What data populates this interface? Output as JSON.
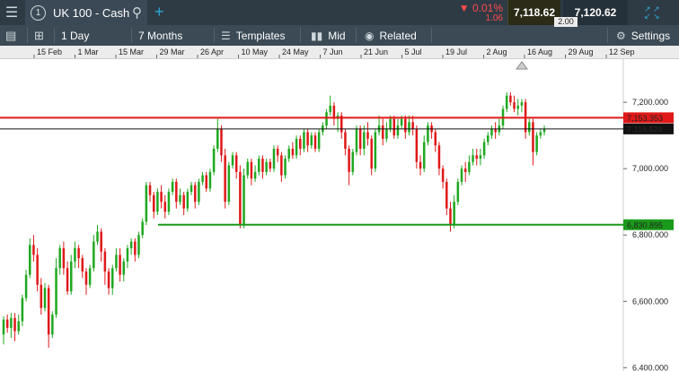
{
  "topbar": {
    "menu_icon": "hamburger-menu-icon",
    "instrument_number": "1",
    "instrument_name": "UK 100 - Cash",
    "change_pct": "▼ 0.01%",
    "change_pts": "1.06",
    "sell_price": "7,118.62",
    "buy_price": "7,120.62",
    "spread": "2.00"
  },
  "toolbar": {
    "interval": "1 Day",
    "period": "7 Months",
    "templates_label": "Templates",
    "price_type": "Mid",
    "related_label": "Related",
    "settings_label": "Settings"
  },
  "colors": {
    "up": "#1fa81f",
    "down": "#e01818",
    "resistance": "#e01818",
    "support": "#1a9a1a",
    "current": "#111111"
  },
  "chart_data": {
    "type": "candlestick",
    "x_ticks": [
      "15 Feb",
      "1 Mar",
      "15 Mar",
      "29 Mar",
      "26 Apr",
      "10 May",
      "24 May",
      "7 Jun",
      "21 Jun",
      "5 Jul",
      "19 Jul",
      "2 Aug",
      "16 Aug",
      "29 Aug",
      "12 Sep"
    ],
    "y_ticks": [
      "7,200.000",
      "7,000.000",
      "6,800.000",
      "6,600.000",
      "6,400.000"
    ],
    "ylim": [
      6390,
      7330
    ],
    "lines": [
      {
        "label": "7,153.353",
        "value": 7153.353,
        "color": "#e01818"
      },
      {
        "label": "7,119.620",
        "value": 7119.62,
        "color": "#111111"
      },
      {
        "label": "6,830.895",
        "value": 6830.895,
        "color": "#1a9a1a"
      }
    ],
    "candles": [
      [
        6500,
        6545,
        6470,
        6555
      ],
      [
        6545,
        6520,
        6505,
        6560
      ],
      [
        6520,
        6550,
        6490,
        6565
      ],
      [
        6550,
        6510,
        6480,
        6565
      ],
      [
        6510,
        6540,
        6500,
        6560
      ],
      [
        6540,
        6610,
        6525,
        6620
      ],
      [
        6610,
        6680,
        6600,
        6695
      ],
      [
        6680,
        6770,
        6670,
        6790
      ],
      [
        6770,
        6740,
        6720,
        6800
      ],
      [
        6740,
        6650,
        6630,
        6760
      ],
      [
        6650,
        6580,
        6560,
        6670
      ],
      [
        6580,
        6640,
        6570,
        6655
      ],
      [
        6640,
        6500,
        6460,
        6650
      ],
      [
        6500,
        6560,
        6490,
        6570
      ],
      [
        6560,
        6700,
        6550,
        6730
      ],
      [
        6700,
        6760,
        6680,
        6770
      ],
      [
        6760,
        6700,
        6680,
        6780
      ],
      [
        6700,
        6630,
        6620,
        6720
      ],
      [
        6630,
        6720,
        6620,
        6740
      ],
      [
        6720,
        6760,
        6700,
        6780
      ],
      [
        6760,
        6730,
        6700,
        6770
      ],
      [
        6730,
        6690,
        6670,
        6740
      ],
      [
        6690,
        6650,
        6620,
        6700
      ],
      [
        6650,
        6700,
        6640,
        6710
      ],
      [
        6700,
        6780,
        6690,
        6800
      ],
      [
        6780,
        6810,
        6770,
        6830
      ],
      [
        6810,
        6750,
        6720,
        6820
      ],
      [
        6750,
        6690,
        6650,
        6760
      ],
      [
        6690,
        6640,
        6620,
        6700
      ],
      [
        6640,
        6700,
        6620,
        6710
      ],
      [
        6700,
        6740,
        6690,
        6760
      ],
      [
        6740,
        6680,
        6660,
        6760
      ],
      [
        6680,
        6720,
        6660,
        6730
      ],
      [
        6720,
        6760,
        6700,
        6770
      ],
      [
        6760,
        6780,
        6740,
        6790
      ],
      [
        6780,
        6740,
        6720,
        6790
      ],
      [
        6740,
        6800,
        6730,
        6810
      ],
      [
        6800,
        6840,
        6790,
        6850
      ],
      [
        6840,
        6950,
        6830,
        6960
      ],
      [
        6950,
        6920,
        6900,
        6960
      ],
      [
        6920,
        6870,
        6850,
        6930
      ],
      [
        6870,
        6930,
        6860,
        6940
      ],
      [
        6930,
        6900,
        6880,
        6950
      ],
      [
        6900,
        6870,
        6850,
        6920
      ],
      [
        6870,
        6930,
        6860,
        6940
      ],
      [
        6930,
        6960,
        6920,
        6970
      ],
      [
        6960,
        6900,
        6880,
        6970
      ],
      [
        6900,
        6920,
        6890,
        6940
      ],
      [
        6920,
        6880,
        6860,
        6930
      ],
      [
        6880,
        6930,
        6870,
        6940
      ],
      [
        6930,
        6950,
        6920,
        6960
      ],
      [
        6950,
        6900,
        6880,
        6960
      ],
      [
        6900,
        6960,
        6890,
        6970
      ],
      [
        6960,
        6980,
        6950,
        6990
      ],
      [
        6980,
        6940,
        6930,
        6990
      ],
      [
        6940,
        6990,
        6930,
        7000
      ],
      [
        6990,
        7060,
        6980,
        7070
      ],
      [
        7060,
        7120,
        7050,
        7150
      ],
      [
        7120,
        7040,
        7020,
        7130
      ],
      [
        7040,
        6900,
        6880,
        7060
      ],
      [
        6900,
        7010,
        6890,
        7020
      ],
      [
        7010,
        7040,
        7000,
        7050
      ],
      [
        7040,
        6990,
        6970,
        7050
      ],
      [
        6990,
        6830,
        6820,
        7010
      ],
      [
        6830,
        6980,
        6820,
        7000
      ],
      [
        6980,
        7020,
        6970,
        7030
      ],
      [
        7020,
        6970,
        6950,
        7030
      ],
      [
        6970,
        6990,
        6960,
        7010
      ],
      [
        6990,
        7030,
        6980,
        7040
      ],
      [
        7030,
        6990,
        6970,
        7040
      ],
      [
        6990,
        7020,
        6980,
        7030
      ],
      [
        7020,
        7000,
        6990,
        7030
      ],
      [
        7000,
        7060,
        6990,
        7070
      ],
      [
        7060,
        7040,
        7020,
        7070
      ],
      [
        7040,
        6980,
        6960,
        7050
      ],
      [
        6980,
        7030,
        6970,
        7040
      ],
      [
        7030,
        7060,
        7020,
        7070
      ],
      [
        7060,
        7040,
        7030,
        7080
      ],
      [
        7040,
        7090,
        7030,
        7100
      ],
      [
        7090,
        7060,
        7040,
        7100
      ],
      [
        7060,
        7110,
        7050,
        7120
      ],
      [
        7110,
        7070,
        7050,
        7120
      ],
      [
        7070,
        7100,
        7060,
        7110
      ],
      [
        7100,
        7060,
        7050,
        7110
      ],
      [
        7060,
        7110,
        7050,
        7120
      ],
      [
        7110,
        7130,
        7100,
        7140
      ],
      [
        7130,
        7170,
        7120,
        7180
      ],
      [
        7170,
        7190,
        7160,
        7220
      ],
      [
        7190,
        7150,
        7130,
        7200
      ],
      [
        7150,
        7160,
        7110,
        7170
      ],
      [
        7160,
        7110,
        7090,
        7170
      ],
      [
        7110,
        7060,
        7040,
        7120
      ],
      [
        7060,
        6990,
        6950,
        7070
      ],
      [
        6990,
        7050,
        6980,
        7060
      ],
      [
        7050,
        7120,
        7040,
        7130
      ],
      [
        7120,
        7060,
        7040,
        7130
      ],
      [
        7060,
        7110,
        7040,
        7130
      ],
      [
        7110,
        7090,
        7070,
        7140
      ],
      [
        7090,
        7000,
        6980,
        7100
      ],
      [
        7000,
        7110,
        6990,
        7120
      ],
      [
        7110,
        7130,
        7100,
        7160
      ],
      [
        7130,
        7090,
        7070,
        7150
      ],
      [
        7090,
        7120,
        7080,
        7140
      ],
      [
        7120,
        7150,
        7110,
        7160
      ],
      [
        7150,
        7100,
        7090,
        7160
      ],
      [
        7100,
        7130,
        7090,
        7150
      ],
      [
        7130,
        7150,
        7120,
        7160
      ],
      [
        7150,
        7110,
        7090,
        7160
      ],
      [
        7110,
        7140,
        7100,
        7160
      ],
      [
        7140,
        7120,
        7100,
        7160
      ],
      [
        7120,
        7020,
        7000,
        7130
      ],
      [
        7020,
        7000,
        6980,
        7040
      ],
      [
        7000,
        7080,
        6990,
        7100
      ],
      [
        7080,
        7130,
        7070,
        7140
      ],
      [
        7130,
        7110,
        7090,
        7140
      ],
      [
        7110,
        7070,
        7050,
        7120
      ],
      [
        7070,
        7000,
        6980,
        7080
      ],
      [
        7000,
        6960,
        6940,
        7010
      ],
      [
        6960,
        6880,
        6860,
        6970
      ],
      [
        6880,
        6830,
        6810,
        6900
      ],
      [
        6830,
        6900,
        6820,
        6920
      ],
      [
        6900,
        6960,
        6890,
        6970
      ],
      [
        6960,
        7000,
        6950,
        7010
      ],
      [
        7000,
        6990,
        6960,
        7020
      ],
      [
        6990,
        7020,
        6980,
        7040
      ],
      [
        7020,
        7040,
        7010,
        7060
      ],
      [
        7040,
        7030,
        7010,
        7060
      ],
      [
        7030,
        7040,
        7010,
        7060
      ],
      [
        7040,
        7080,
        7030,
        7090
      ],
      [
        7080,
        7100,
        7070,
        7110
      ],
      [
        7100,
        7120,
        7090,
        7130
      ],
      [
        7120,
        7110,
        7090,
        7140
      ],
      [
        7110,
        7130,
        7100,
        7150
      ],
      [
        7130,
        7180,
        7120,
        7190
      ],
      [
        7180,
        7220,
        7170,
        7230
      ],
      [
        7220,
        7200,
        7190,
        7230
      ],
      [
        7200,
        7180,
        7170,
        7220
      ],
      [
        7180,
        7190,
        7160,
        7210
      ],
      [
        7190,
        7200,
        7170,
        7210
      ],
      [
        7200,
        7110,
        7090,
        7210
      ],
      [
        7110,
        7140,
        7100,
        7150
      ],
      [
        7140,
        7050,
        7010,
        7150
      ],
      [
        7050,
        7100,
        7040,
        7110
      ],
      [
        7100,
        7110,
        7090,
        7120
      ],
      [
        7110,
        7120,
        7100,
        7130
      ]
    ]
  }
}
